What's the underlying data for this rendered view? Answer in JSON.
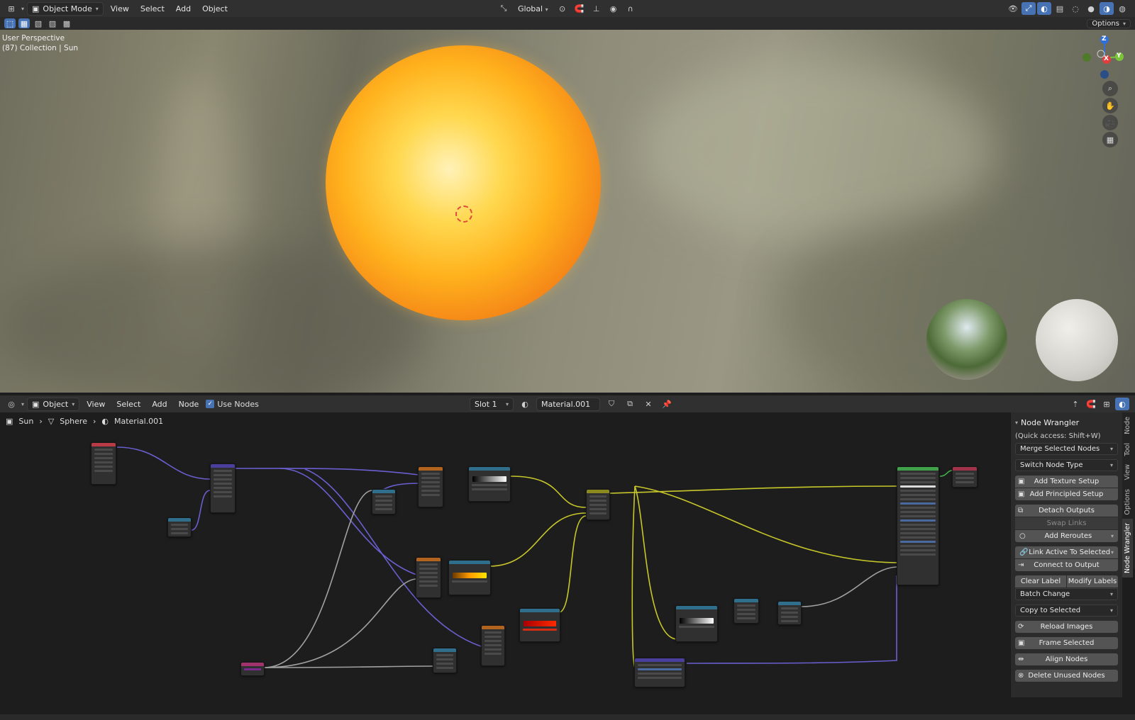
{
  "viewport_header": {
    "mode": "Object Mode",
    "menus": [
      "View",
      "Select",
      "Add",
      "Object"
    ],
    "transform": "Global",
    "options": "Options"
  },
  "viewport": {
    "line1": "User Perspective",
    "line2": "(87) Collection | Sun",
    "gizmo": {
      "z": "Z",
      "x": "X",
      "y": "Y"
    }
  },
  "node_header": {
    "editor_type": "Object",
    "menus": [
      "View",
      "Select",
      "Add",
      "Node"
    ],
    "use_nodes": "Use Nodes",
    "slot": "Slot 1",
    "material": "Material.001"
  },
  "breadcrumb": [
    "Sun",
    "Sphere",
    "Material.001"
  ],
  "panel": {
    "title": "Node Wrangler",
    "quick_access": "(Quick access: Shift+W)",
    "merge": "Merge Selected Nodes",
    "switch": "Switch Node Type",
    "add_texture": "Add Texture Setup",
    "add_principled": "Add Principled Setup",
    "detach": "Detach Outputs",
    "swap": "Swap Links",
    "reroutes": "Add Reroutes",
    "link_active": "Link Active To Selected",
    "connect": "Connect to Output",
    "clear_label": "Clear Label",
    "modify_labels": "Modify Labels",
    "batch": "Batch Change",
    "copy": "Copy to Selected",
    "reload": "Reload Images",
    "frame": "Frame Selected",
    "align": "Align Nodes",
    "delete": "Delete Unused Nodes"
  },
  "tabs": [
    "Node",
    "Tool",
    "View",
    "Options",
    "Node Wrangler"
  ],
  "colors": {
    "accent": "#4772b3",
    "wire_vector": "#6a5fd0",
    "wire_color": "#c7c72a",
    "wire_float": "#a1a1a1",
    "wire_shader": "#3fb24a"
  }
}
